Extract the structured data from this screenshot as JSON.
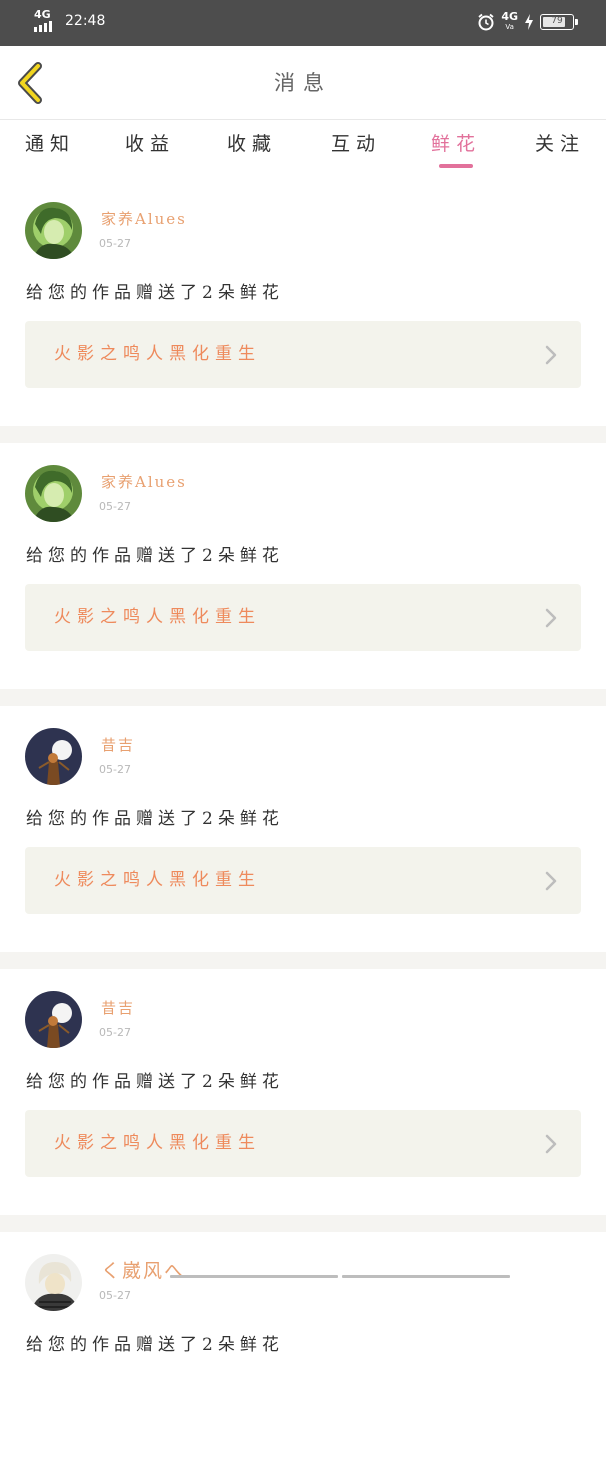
{
  "status_bar": {
    "network": "4G",
    "time": "22:48",
    "network_right": "4G",
    "network_right_sub": "Va",
    "battery": "79"
  },
  "header": {
    "title": "消息",
    "back_icon": "chevron-left-icon"
  },
  "tabs": [
    {
      "label": "通知",
      "active": false
    },
    {
      "label": "收益",
      "active": false
    },
    {
      "label": "收藏",
      "active": false
    },
    {
      "label": "互动",
      "active": false
    },
    {
      "label": "鲜花",
      "active": true
    },
    {
      "label": "关注",
      "active": false
    }
  ],
  "colors": {
    "accent_pink": "#e2719b",
    "username_orange": "#e8a070",
    "work_title_orange": "#ee8a5c",
    "link_bg": "#f3f3ec"
  },
  "notifications": [
    {
      "user": "家养Alues",
      "date": "05-27",
      "message": "给您的作品赠送了2朵鲜花",
      "work": "火影之鸣人黑化重生",
      "avatar": "green-anime-avatar"
    },
    {
      "user": "家养Alues",
      "date": "05-27",
      "message": "给您的作品赠送了2朵鲜花",
      "work": "火影之鸣人黑化重生",
      "avatar": "green-anime-avatar"
    },
    {
      "user": "昔吉",
      "date": "05-27",
      "message": "给您的作品赠送了2朵鲜花",
      "work": "火影之鸣人黑化重生",
      "avatar": "moon-night-avatar"
    },
    {
      "user": "昔吉",
      "date": "05-27",
      "message": "给您的作品赠送了2朵鲜花",
      "work": "火影之鸣人黑化重生",
      "avatar": "moon-night-avatar"
    },
    {
      "user": "く崴风へ",
      "date": "05-27",
      "message": "给您的作品赠送了2朵鲜花",
      "work": "",
      "avatar": "character-avatar"
    }
  ]
}
